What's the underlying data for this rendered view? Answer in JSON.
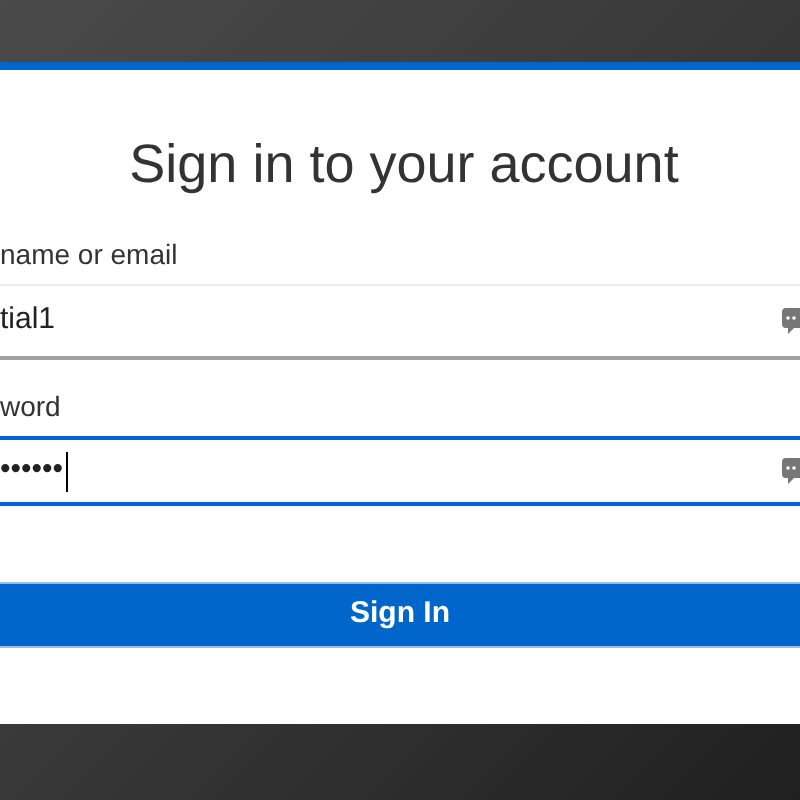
{
  "title": "Sign in to your account",
  "fields": [
    {
      "label": "name or email",
      "value": "tial1",
      "focused": false
    },
    {
      "label": "word",
      "value": "••••••",
      "focused": true
    }
  ],
  "button": "Sign In"
}
